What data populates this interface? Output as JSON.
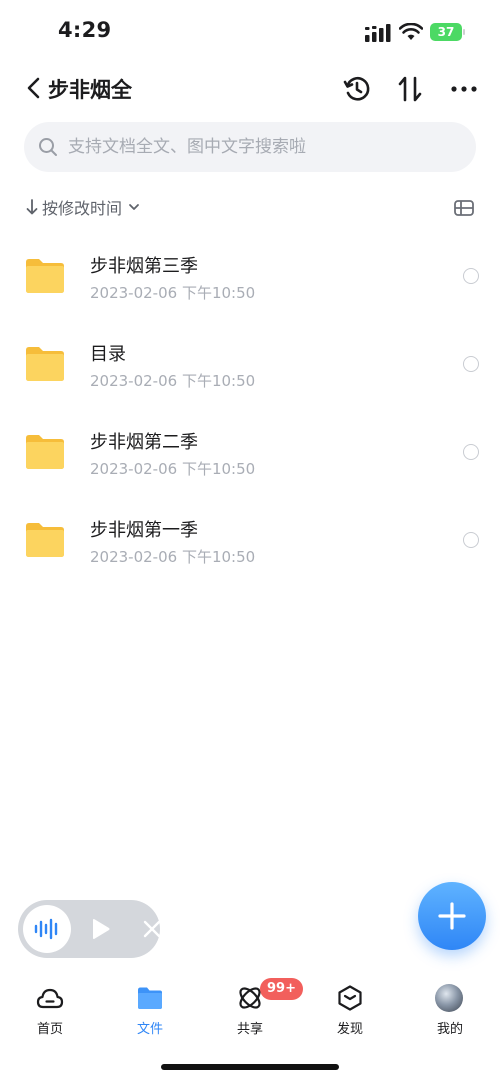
{
  "status_bar": {
    "time": "4:29",
    "battery": "37"
  },
  "header": {
    "title": "步非烟全",
    "icons": [
      "back-icon",
      "history-icon",
      "sort-icon",
      "more-icon"
    ]
  },
  "search": {
    "placeholder": "支持文档全文、图中文字搜索啦",
    "value": ""
  },
  "sort": {
    "label": "按修改时间"
  },
  "files": [
    {
      "name": "步非烟第三季",
      "date": "2023-02-06 下午10:50",
      "type": "folder"
    },
    {
      "name": "目录",
      "date": "2023-02-06 下午10:50",
      "type": "folder"
    },
    {
      "name": "步非烟第二季",
      "date": "2023-02-06 下午10:50",
      "type": "folder"
    },
    {
      "name": "步非烟第一季",
      "date": "2023-02-06 下午10:50",
      "type": "folder"
    }
  ],
  "tabs": [
    {
      "label": "首页",
      "icon": "cloud-icon",
      "active": false
    },
    {
      "label": "文件",
      "icon": "folder-icon",
      "active": true
    },
    {
      "label": "共享",
      "icon": "share-icon",
      "active": false,
      "badge": "99+"
    },
    {
      "label": "发现",
      "icon": "discover-icon",
      "active": false
    },
    {
      "label": "我的",
      "icon": "avatar",
      "active": false
    }
  ],
  "colors": {
    "accent": "#2f86f6",
    "folder": "#fbd05a",
    "badge": "#f25f5c",
    "battery": "#4cd964"
  }
}
